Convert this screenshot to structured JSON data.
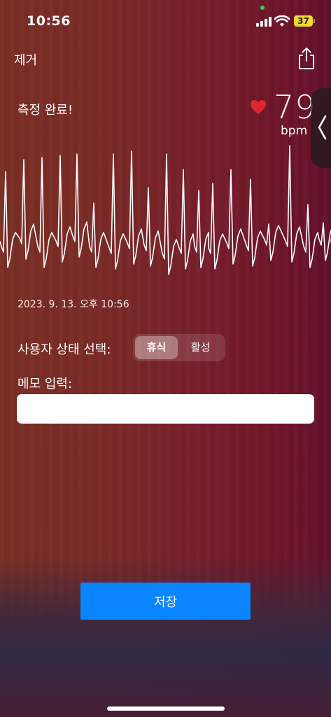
{
  "status_bar": {
    "time": "10:56",
    "battery": "37",
    "battery_color": "#f1d82b",
    "camera_dot_color": "#2fd158"
  },
  "nav": {
    "remove_label": "제거",
    "share_icon": "share-icon"
  },
  "measurement": {
    "status": "측정 완료!",
    "heart_icon": "heart-icon",
    "heart_color": "#e0262f",
    "bpm_value": "79",
    "bpm_unit": "bpm",
    "timestamp": "2023. 9. 13. 오후 10:56"
  },
  "side_panel": {
    "handle_icon": "chevron-left-icon"
  },
  "user_state": {
    "label": "사용자 상태 선택:",
    "options": [
      "휴식",
      "활성"
    ],
    "selected": "휴식"
  },
  "memo": {
    "label": "메모 입력:",
    "value": "",
    "placeholder": ""
  },
  "actions": {
    "save_label": "저장",
    "save_color": "#0a84ff"
  }
}
